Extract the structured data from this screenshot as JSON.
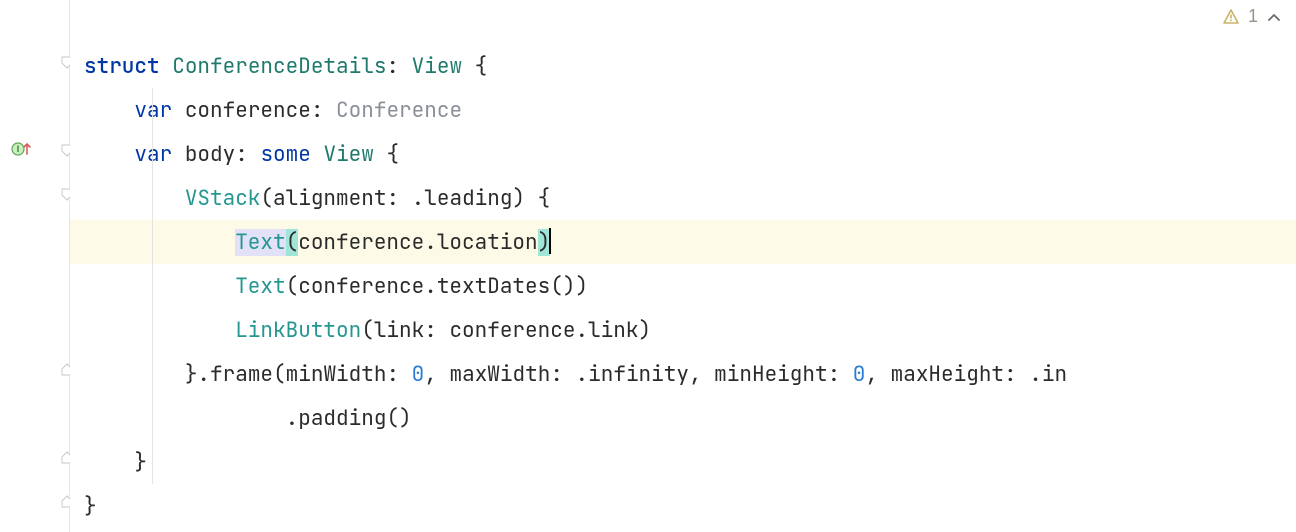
{
  "warnings": {
    "count": "1"
  },
  "code": {
    "l1": {
      "kw": "struct",
      "name": "ConferenceDetails",
      "colon": ":",
      "type": "View",
      "brace": " {"
    },
    "l2": {
      "kw": "var",
      "name": "conference",
      "colon": ":",
      "type": "Conference"
    },
    "l3": {
      "kw": "var",
      "name": "body",
      "colon": ":",
      "some": "some",
      "type": "View",
      "brace": " {"
    },
    "l4": {
      "call": "VStack",
      "open": "(",
      "param": "alignment",
      "colon": ":",
      "dot": ".",
      "val": "leading",
      "close": ")",
      "brace": " {"
    },
    "l5": {
      "call": "Text",
      "open": "(",
      "obj": "conference",
      "dot": ".",
      "prop": "location",
      "close": ")"
    },
    "l6": {
      "call": "Text",
      "open": "(",
      "obj": "conference",
      "dot": ".",
      "meth": "textDates",
      "open2": "(",
      "close2": ")",
      "close": ")"
    },
    "l7": {
      "call": "LinkButton",
      "open": "(",
      "param": "link",
      "colon": ":",
      "obj": "conference",
      "dot": ".",
      "prop": "link",
      "close": ")"
    },
    "l8": {
      "brace": "}",
      "dot": ".",
      "meth": "frame",
      "open": "(",
      "p1": "minWidth",
      "c1": ":",
      "v1": "0",
      "s1": ",",
      "p2": "maxWidth",
      "c2": ":",
      "d2": ".",
      "v2": "infinity",
      "s2": ",",
      "p3": "minHeight",
      "c3": ":",
      "v3": "0",
      "s3": ",",
      "p4": "maxHeight",
      "c4": ":",
      "d4": ".",
      "v4": "in"
    },
    "l9": {
      "dot": ".",
      "meth": "padding",
      "open": "(",
      "close": ")"
    },
    "l10": {
      "brace": "}"
    },
    "l11": {
      "brace": "}"
    }
  }
}
